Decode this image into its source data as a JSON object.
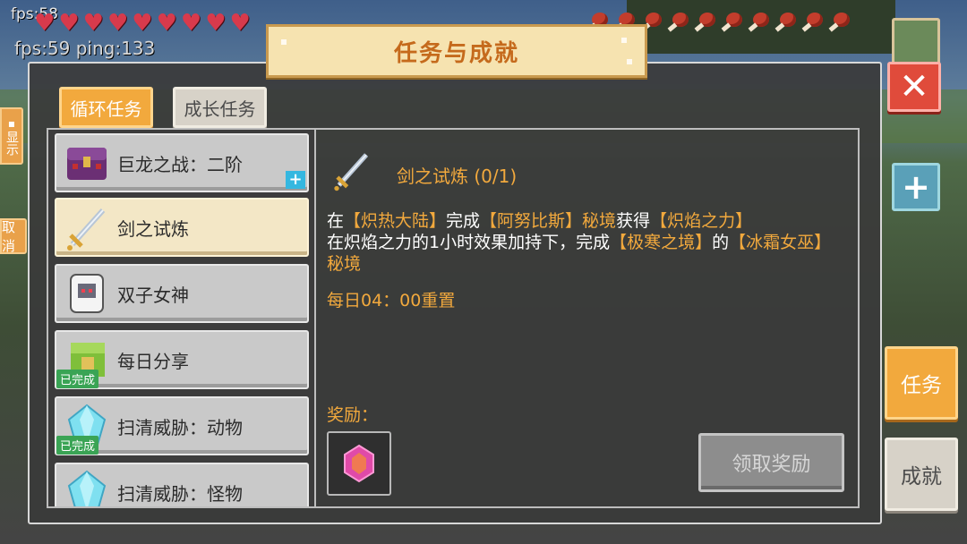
{
  "hud": {
    "fps_top": "fps:58",
    "fps_ping": "fps:59 ping:133",
    "hearts": [
      "♥",
      "♥",
      "♥",
      "♥",
      "♥",
      "♥",
      "♥",
      "♥",
      "♥"
    ],
    "food_count": 10
  },
  "window": {
    "title": "任务与成就",
    "close_symbol": "✕"
  },
  "tabs": [
    {
      "label": "循环任务",
      "active": true
    },
    {
      "label": "成长任务",
      "active": false
    }
  ],
  "task_list": [
    {
      "label": "巨龙之战：二阶",
      "icon": "treasure-chest-icon",
      "badge": "+",
      "completed": false
    },
    {
      "label": "剑之试炼",
      "icon": "sword-icon",
      "selected": true,
      "completed": false
    },
    {
      "label": "双子女神",
      "icon": "twin-goddess-icon",
      "completed": false
    },
    {
      "label": "每日分享",
      "icon": "share-box-icon",
      "completed": true
    },
    {
      "label": "扫清威胁：动物",
      "icon": "blue-crystal-icon",
      "completed": true
    },
    {
      "label": "扫清威胁：怪物",
      "icon": "blue-crystal-icon",
      "completed": false
    }
  ],
  "completed_badge": "已完成",
  "detail": {
    "title": "剑之试炼 (0/1)",
    "line1": [
      "在",
      "【炽热大陆】",
      "完成",
      "【阿努比斯】秘境",
      "获得",
      "【炽焰之力】"
    ],
    "line2": [
      "在炽焰之力的1小时效果加持下，完成",
      "【极寒之境】",
      "的",
      "【冰霜女巫】秘境"
    ],
    "reset": "每日04：00重置",
    "reward_label": "奖励：",
    "reward_icon": "pink-gem-icon",
    "claim_button": "领取奖励"
  },
  "side": {
    "task_button": "任务",
    "achievement_button": "成就"
  },
  "left_edge": {
    "show": "显示",
    "cancel": "取消"
  },
  "colors": {
    "accent_orange": "#f2a93d",
    "close_red": "#e04b3b",
    "complete_green": "#3aa455"
  }
}
